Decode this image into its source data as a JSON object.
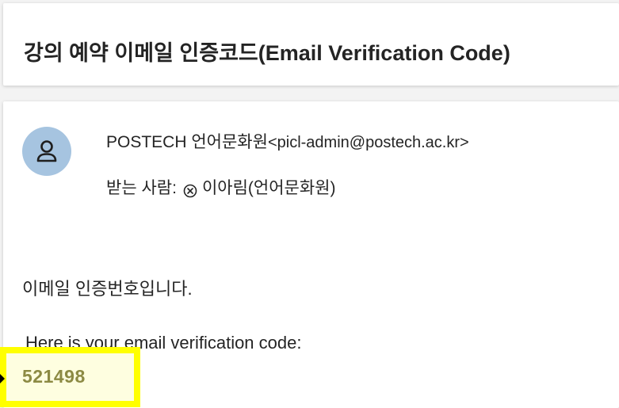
{
  "email": {
    "subject": "강의 예약 이메일 인증코드(Email Verification Code)",
    "sender": {
      "name": "POSTECH 언어문화원",
      "address": "<picl-admin@postech.ac.kr>",
      "avatar_icon": "person-icon"
    },
    "recipients": {
      "label": "받는 사람:",
      "remove_icon": "circle-x-icon",
      "name": "이아림(언어문화원)"
    },
    "body": {
      "heading": "이메일 인증번호입니다.",
      "english_line": "Here is your email verification code:",
      "code": "521498"
    }
  },
  "colors": {
    "highlight_border": "#ffff00",
    "highlight_fill": "#fefee0",
    "code_text": "#8c8a43",
    "avatar_bg": "#a6c4e0"
  }
}
